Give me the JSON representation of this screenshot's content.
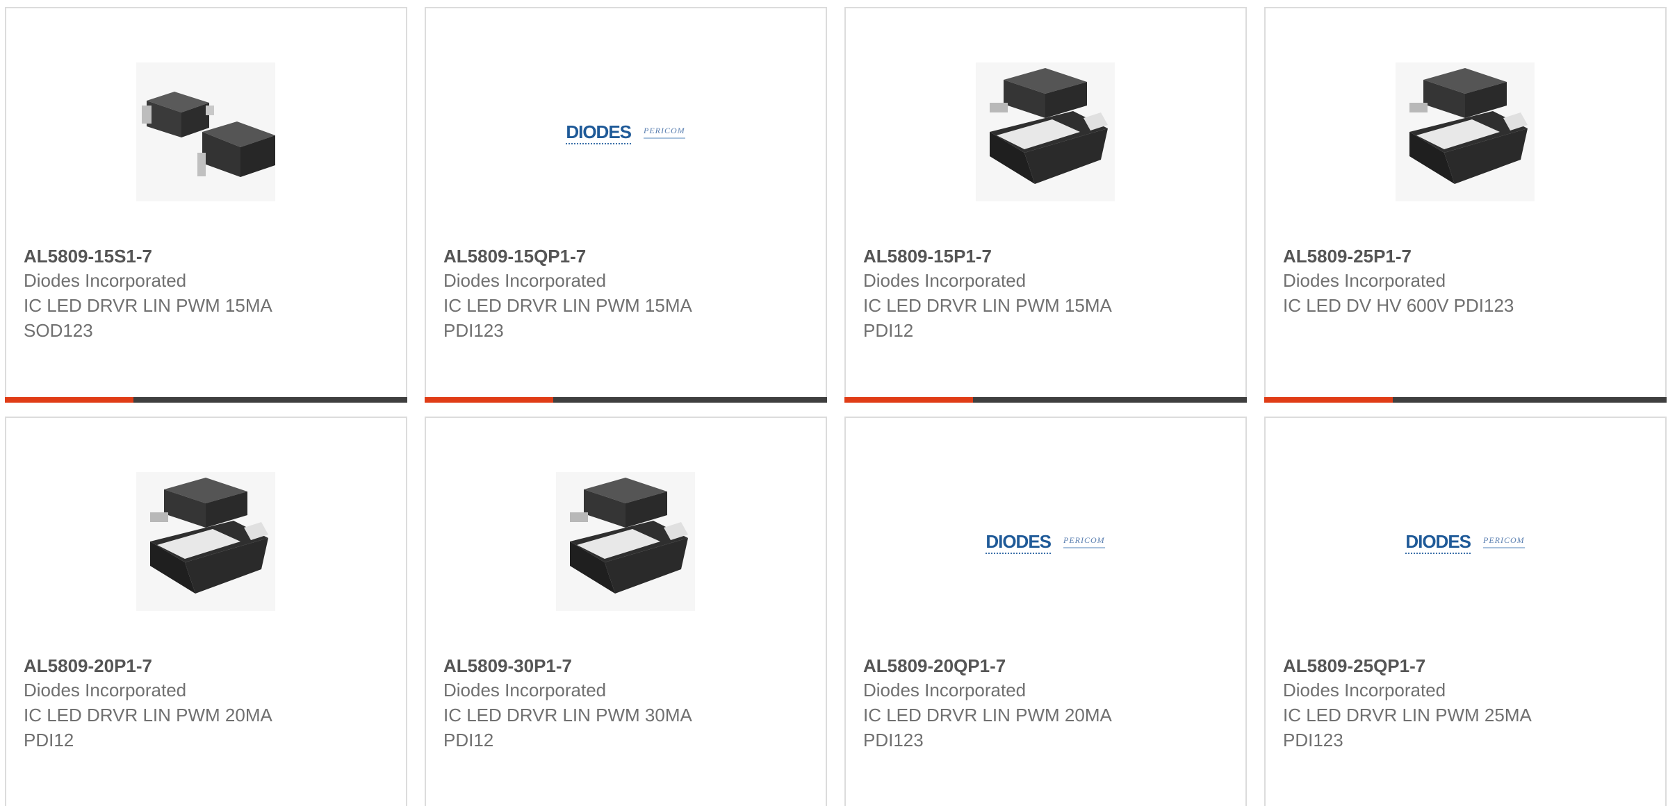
{
  "accent_color": "#e03c16",
  "bar_color": "#3f3f3f",
  "products": [
    {
      "part": "AL5809-15S1-7",
      "manufacturer": "Diodes Incorporated",
      "description": "IC LED DRVR LIN PWM 15MA\nSOD123",
      "image": "sod123-package",
      "progress": 0.32
    },
    {
      "part": "AL5809-15QP1-7",
      "manufacturer": "Diodes Incorporated",
      "description": "IC LED DRVR LIN PWM 15MA\nPDI123",
      "image": "diodes-pericom-logo",
      "logo_text": "DIODES",
      "logo_sub": "PERICOM",
      "progress": 0.32
    },
    {
      "part": "AL5809-15P1-7",
      "manufacturer": "Diodes Incorporated",
      "description": "IC LED DRVR LIN PWM 15MA\nPDI12",
      "image": "pdi123-package",
      "progress": 0.32
    },
    {
      "part": "AL5809-25P1-7",
      "manufacturer": "Diodes Incorporated",
      "description": "IC LED DV HV 600V PDI123",
      "image": "pdi123-package",
      "progress": 0.32
    },
    {
      "part": "AL5809-20P1-7",
      "manufacturer": "Diodes Incorporated",
      "description": "IC LED DRVR LIN PWM 20MA\nPDI12",
      "image": "pdi123-package"
    },
    {
      "part": "AL5809-30P1-7",
      "manufacturer": "Diodes Incorporated",
      "description": "IC LED DRVR LIN PWM 30MA\nPDI12",
      "image": "pdi123-package"
    },
    {
      "part": "AL5809-20QP1-7",
      "manufacturer": "Diodes Incorporated",
      "description": "IC LED DRVR LIN PWM 20MA\nPDI123",
      "image": "diodes-pericom-logo",
      "logo_text": "DIODES",
      "logo_sub": "PERICOM"
    },
    {
      "part": "AL5809-25QP1-7",
      "manufacturer": "Diodes Incorporated",
      "description": "IC LED DRVR LIN PWM 25MA\nPDI123",
      "image": "diodes-pericom-logo",
      "logo_text": "DIODES",
      "logo_sub": "PERICOM"
    }
  ]
}
